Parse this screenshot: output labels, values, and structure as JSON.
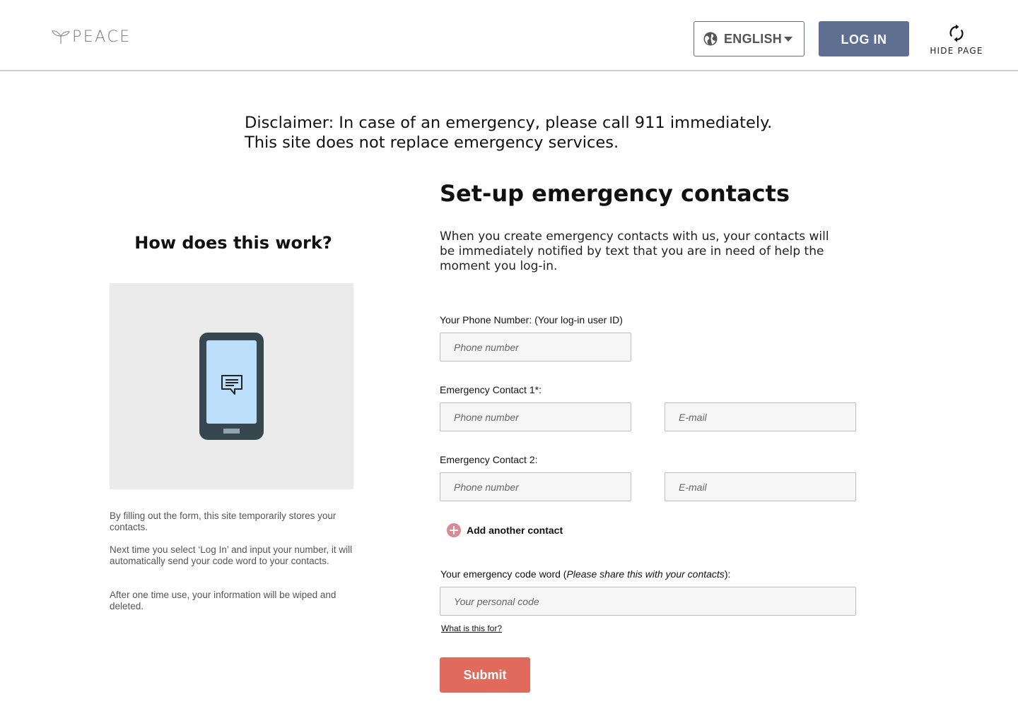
{
  "header": {
    "logo_text": "PEACE",
    "language_label": "ENGLISH",
    "login_label": "LOG IN",
    "hide_page_label": "HIDE PAGE"
  },
  "disclaimer": {
    "line1": "Disclaimer: In case of an emergency, please call 911 immediately.",
    "line2": "This site does not replace emergency services."
  },
  "how": {
    "title": "How does this work?",
    "paragraphs": [
      "By filling out the form, this site temporarily stores your contacts.",
      "Next time you select ‘Log In’ and input your number, it will automatically send your code word to your contacts.",
      "After one time use, your information will be wiped and deleted."
    ]
  },
  "form": {
    "title": "Set-up emergency contacts",
    "intro": "When you create emergency contacts with us, your contacts will be immediately notified by text that you are in need of help the moment you log-in.",
    "phone_label": "Your Phone Number: (Your log-in user ID)",
    "phone_placeholder": "Phone number",
    "contact1_label": "Emergency Contact 1*:",
    "contact2_label": "Emergency Contact 2:",
    "contact_phone_placeholder": "Phone number",
    "contact_email_placeholder": "E-mail",
    "add_contact_label": "Add another contact",
    "code_label_prefix": "Your emergency code word (",
    "code_label_italic": "Please share this with your contacts",
    "code_label_suffix": "):",
    "code_placeholder": "Your personal code",
    "what_link": "What is this for?",
    "submit_label": "Submit"
  },
  "colors": {
    "login_button": "#5f6f92",
    "submit_button": "#e06b5c",
    "add_icon": "#d98a96",
    "phone_body": "#37474f",
    "phone_screen": "#bbdefb"
  },
  "icons": [
    "sprout-logo-icon",
    "globe-icon",
    "caret-down-icon",
    "refresh-icon",
    "chat-icon",
    "plus-circle-icon"
  ]
}
